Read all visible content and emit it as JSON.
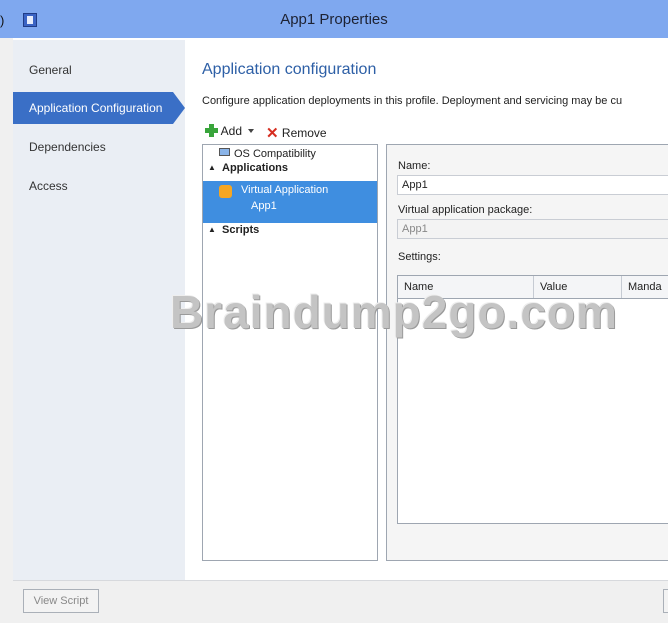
{
  "window": {
    "title": "App1 Properties",
    "stray_char": ")"
  },
  "sidebar": {
    "items": [
      {
        "label": "General",
        "active": false
      },
      {
        "label": "Application Configuration",
        "active": true
      },
      {
        "label": "Dependencies",
        "active": false
      },
      {
        "label": "Access",
        "active": false
      }
    ]
  },
  "main": {
    "title": "Application configuration",
    "description": "Configure application deployments in this profile. Deployment and servicing may be cu",
    "toolbar": {
      "add_label": "Add",
      "remove_label": "Remove"
    },
    "tree": {
      "os_compatibility": "OS Compatibility",
      "applications_group": "Applications",
      "selected_app_name": "Virtual Application",
      "selected_app_sub": "App1",
      "scripts_group": "Scripts"
    },
    "detail": {
      "name_label": "Name:",
      "name_value": "App1",
      "package_label": "Virtual application package:",
      "package_value": "App1",
      "settings_label": "Settings:",
      "columns": [
        "Name",
        "Value",
        "Manda"
      ]
    }
  },
  "watermark": "Braindump2go.com",
  "footer": {
    "view_script_label": "View Script"
  },
  "colors": {
    "titlebar": "#7fa8ef",
    "accent": "#3a6fc6",
    "selection": "#3f8ee0",
    "heading": "#2d5fa6"
  }
}
